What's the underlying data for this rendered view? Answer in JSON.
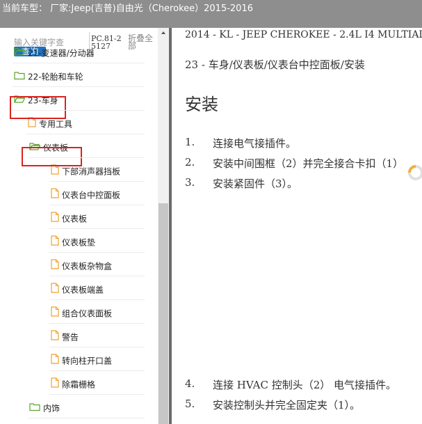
{
  "header": {
    "title": "当前车型： 厂家:Jeep(吉普)自由光（Cherokee）2015-2016"
  },
  "sidebar": {
    "search_placeholder": "输入关键字查",
    "search_button": "查询",
    "pc_code": "PC.81-25127",
    "collapse_all": "折叠全部",
    "tree": [
      {
        "label": "21-变速器/分动器",
        "icon": "folder-open-icon"
      },
      {
        "label": "22-轮胎和车轮",
        "icon": "folder-icon"
      },
      {
        "label": "23-车身",
        "icon": "folder-open-icon"
      },
      {
        "label": "专用工具",
        "icon": "file-icon"
      },
      {
        "label": "仪表板",
        "icon": "folder-open-icon"
      },
      {
        "label": "下部消声器挡板",
        "icon": "file-icon"
      },
      {
        "label": "仪表台中控面板",
        "icon": "file-icon"
      },
      {
        "label": "仪表板",
        "icon": "file-icon"
      },
      {
        "label": "仪表板垫",
        "icon": "file-icon"
      },
      {
        "label": "仪表板杂物盒",
        "icon": "file-icon"
      },
      {
        "label": "仪表板端盖",
        "icon": "file-icon"
      },
      {
        "label": "组合仪表面板",
        "icon": "file-icon"
      },
      {
        "label": "警告",
        "icon": "file-icon"
      },
      {
        "label": "转向柱开口盖",
        "icon": "file-icon"
      },
      {
        "label": "除霜栅格",
        "icon": "file-icon"
      },
      {
        "label": "内饰",
        "icon": "folder-icon"
      }
    ]
  },
  "document": {
    "vehicle_line": "2014 - KL - JEEP CHEROKEE - 2.4L I4 MULTIAIR",
    "breadcrumb": "23 - 车身/仪表板/仪表台中控面板/安装",
    "heading": "安装",
    "steps_top": [
      {
        "num": "1.",
        "text": "连接电气接插件。"
      },
      {
        "num": "2.",
        "text": "安装中间围框（2）并完全接合卡扣（1）"
      },
      {
        "num": "3.",
        "text": "安装紧固件（3）。"
      }
    ],
    "steps_bottom": [
      {
        "num": "4.",
        "text": "连接 HVAC 控制头（2） 电气接插件。"
      },
      {
        "num": "5.",
        "text": "安装控制头并完全固定夹（1）。"
      }
    ]
  },
  "colors": {
    "header_bg": "#8e8e8e",
    "button_blue": "#1e73be",
    "highlight_red": "#d9231f",
    "folder_green": "#5aa52b",
    "file_orange": "#f0a030"
  }
}
